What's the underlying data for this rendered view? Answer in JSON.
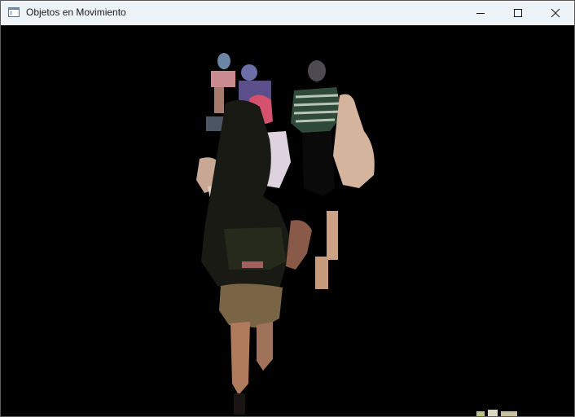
{
  "window": {
    "title": "Objetos en Movimiento",
    "icon": "app-window-icon"
  },
  "controls": {
    "minimize_icon": "minimize-icon",
    "maximize_icon": "maximize-icon",
    "close_icon": "close-icon"
  },
  "content": {
    "background_color": "#000000",
    "description_icon": "motion-mask-frame"
  }
}
